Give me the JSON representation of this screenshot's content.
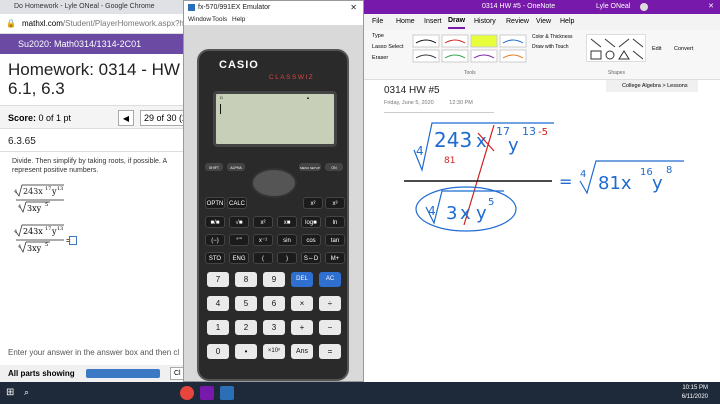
{
  "chrome": {
    "title": "Do Homework - Lyle ONeal - Google Chrome",
    "url_prefix": "mathxl.com",
    "url_path": "/Student/PlayerHomework.aspx?homeworkId",
    "subheader": "Su2020: Math0314/1314-2C01",
    "hw_title_1": "Homework: 0314 - HW",
    "hw_title_2": "6.1, 6.3",
    "score_label": "Score:",
    "score_value": "0 of 1 pt",
    "question_nav": "29 of 30 (2",
    "question_id": "6.3.65",
    "prompt_1": "Divide.  Then simplify by taking roots, if possible.  A",
    "prompt_2": "represent positive numbers.",
    "answer_instr": "Enter your answer in the answer box and then cl",
    "parts_label": "All parts showing",
    "clear_label": "Cl"
  },
  "emulator": {
    "title": "fx-570/991EX Emulator",
    "menu": [
      "Window",
      "Tools",
      "Help"
    ],
    "brand": "CASIO",
    "model": "CLASSWIZ",
    "keys_fn": [
      "SHIFT",
      "ALPHA",
      "MENU SETUP",
      "ON"
    ],
    "keys_row1": [
      "OPTN",
      "CALC",
      "x²",
      "x³"
    ],
    "keys_row2": [
      "■/■",
      "√■",
      "x²",
      "x■",
      "log■",
      "ln"
    ],
    "keys_row3": [
      "(−)",
      "°'\"",
      "x⁻¹",
      "sin",
      "cos",
      "tan"
    ],
    "keys_row4": [
      "STO",
      "ENG",
      "(",
      ")",
      "S⇔D",
      "M+"
    ],
    "numrow1": [
      "7",
      "8",
      "9",
      "DEL",
      "AC"
    ],
    "numrow2": [
      "4",
      "5",
      "6",
      "×",
      "÷"
    ],
    "numrow3": [
      "1",
      "2",
      "3",
      "+",
      "−"
    ],
    "numrow4": [
      "0",
      "•",
      "×10ˣ",
      "Ans",
      "="
    ]
  },
  "onenote": {
    "title": "0314 HW #5  -  OneNote",
    "user": "Lyle ONeal",
    "tabs": [
      "File",
      "Home",
      "Insert",
      "Draw",
      "History",
      "Review",
      "View",
      "Help"
    ],
    "tools_label": "Tools",
    "shapes_label": "Shapes",
    "type_label": "Type",
    "lasso_label": "Lasso Select",
    "eraser_label": "Eraser",
    "color_thickness": "Color & Thickness",
    "draw_touch": "Draw with Touch",
    "edit_label": "Edit",
    "convert_label": "Convert",
    "notebook_tab": "College Algebra > Lessons",
    "page_title": "0314 HW #5",
    "page_date": "Friday, June 5, 2020",
    "page_time": "12:30 PM"
  },
  "taskbar": {
    "time": "10:15 PM",
    "date": "6/11/2020"
  },
  "colors": {
    "chrome_sub": "#6b4aa3",
    "onenote_purple": "#7719aa",
    "ink_red": "#d02020",
    "ink_blue": "#1f6bd0"
  }
}
